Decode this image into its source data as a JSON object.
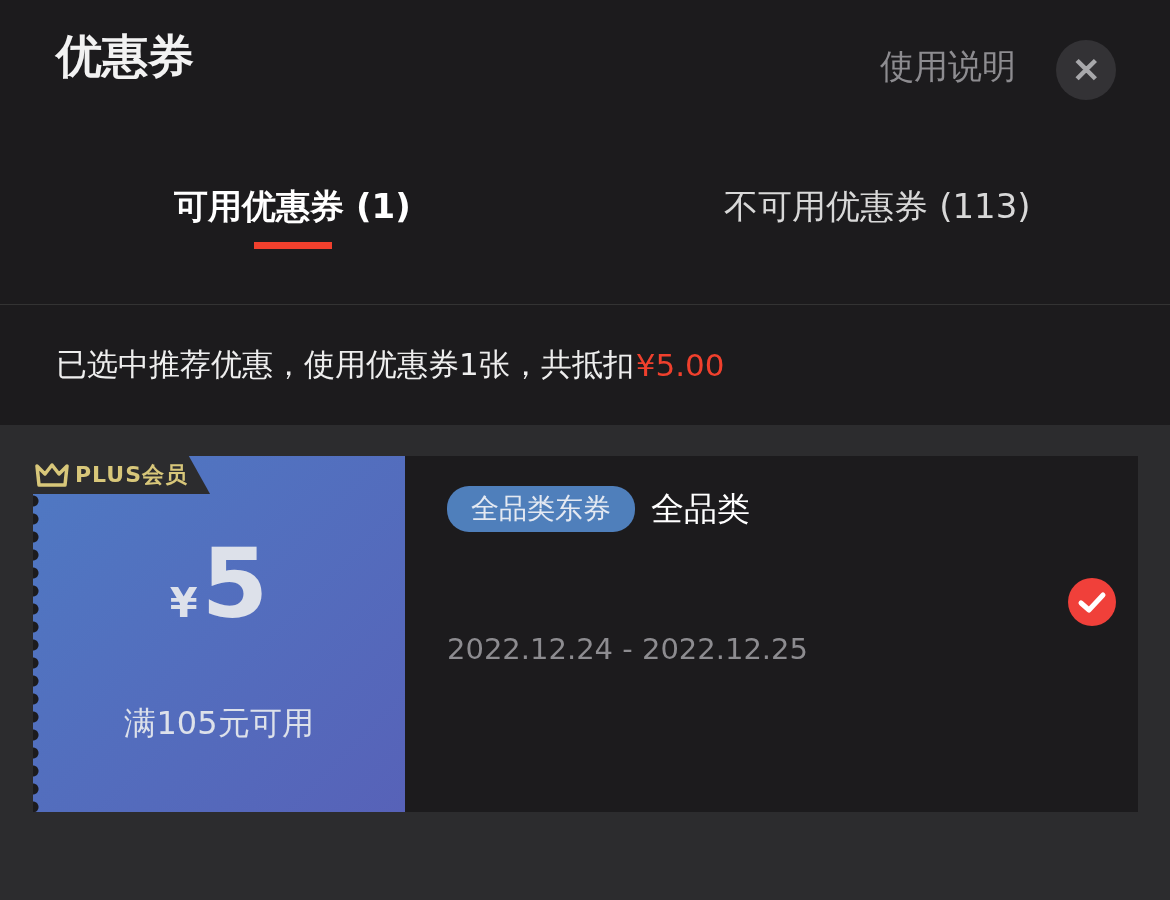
{
  "header": {
    "title": "优惠券",
    "help_link": "使用说明",
    "close_button": "✕"
  },
  "tabs": [
    {
      "label": "可用优惠券 (1)",
      "selected": true
    },
    {
      "label": "不可用优惠券 (113)",
      "selected": false
    }
  ],
  "summary": {
    "text": "已选中推荐优惠，使用优惠券1张，共抵扣",
    "amount": "¥5.00"
  },
  "coupons": [
    {
      "badge": "PLUS会员",
      "currency": "¥",
      "value": "5",
      "condition": "满105元可用",
      "tag": "全品类东券",
      "scope": "全品类",
      "validity": "2022.12.24 - 2022.12.25",
      "selected": true
    }
  ]
}
